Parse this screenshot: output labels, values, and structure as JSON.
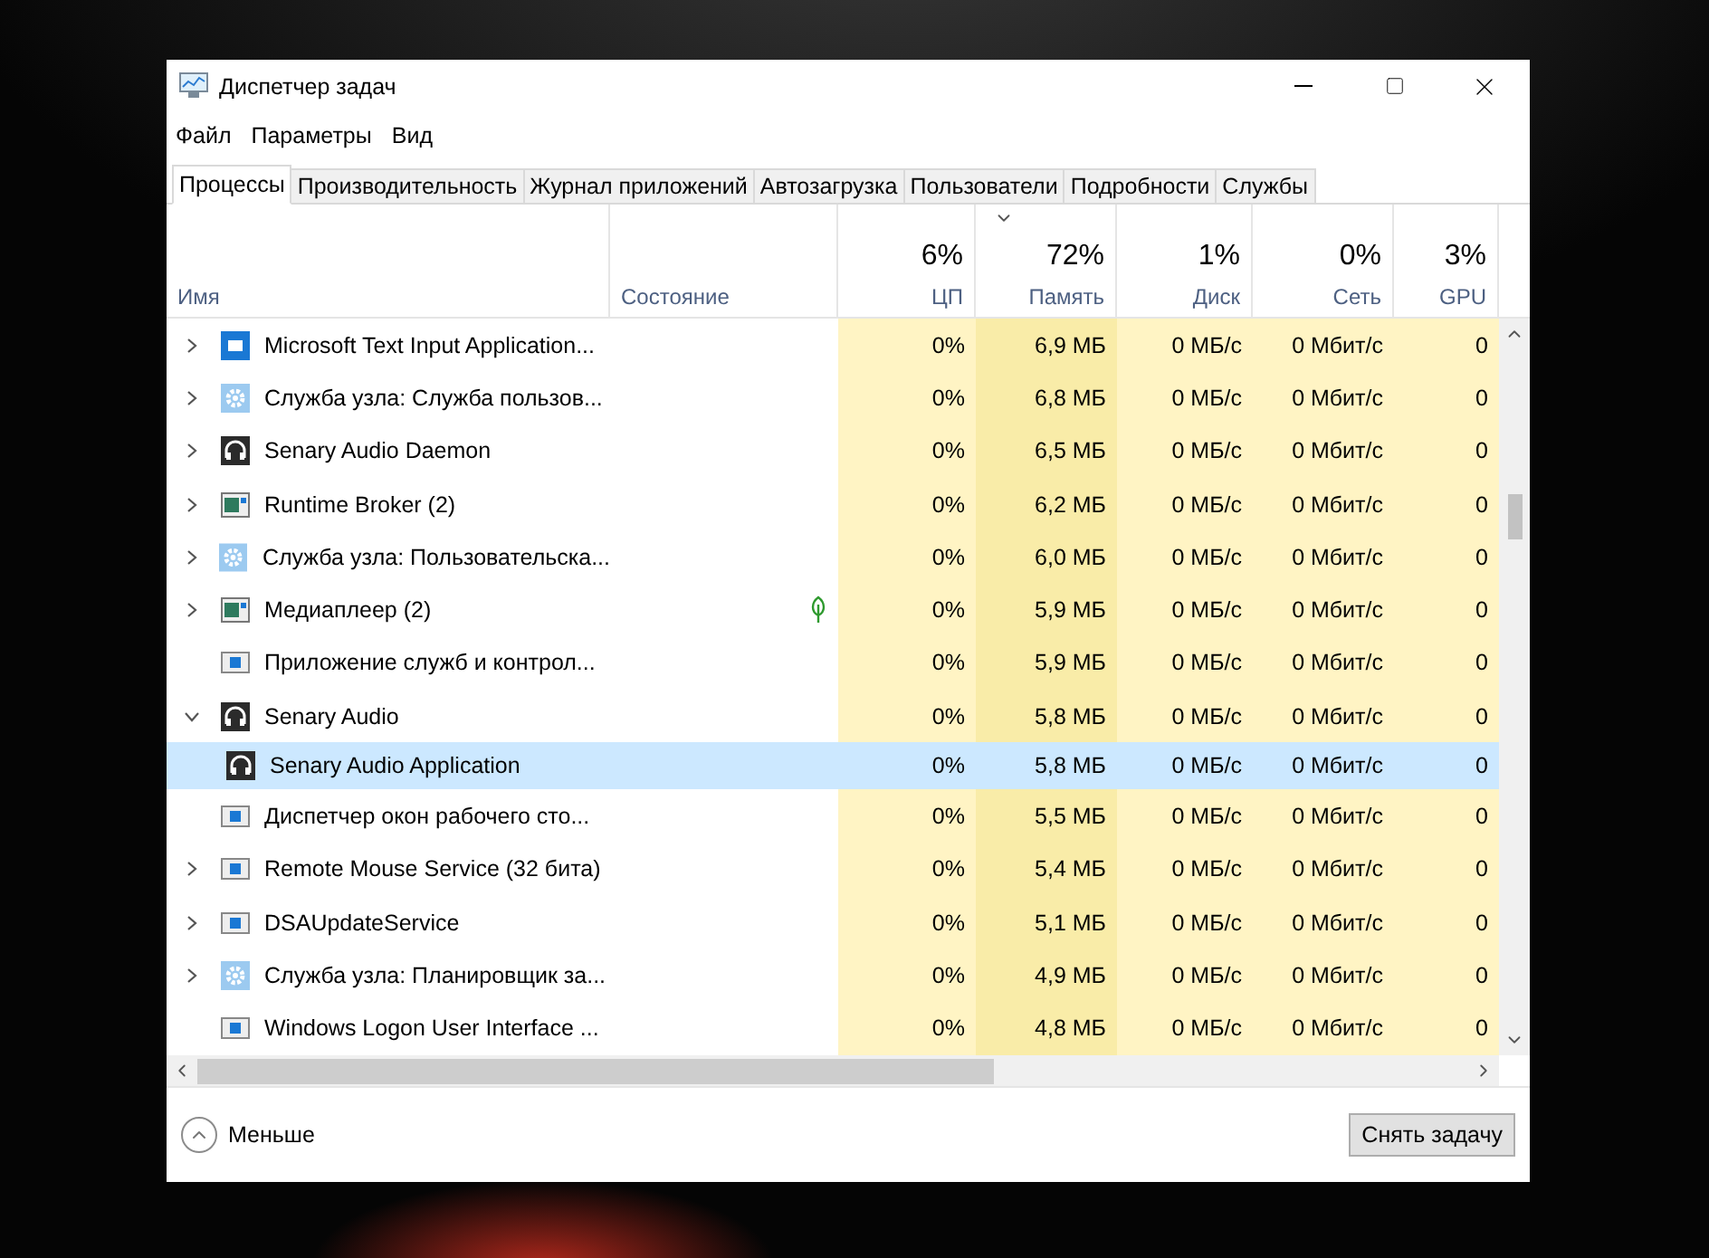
{
  "window": {
    "title": "Диспетчер задач"
  },
  "menu": [
    "Файл",
    "Параметры",
    "Вид"
  ],
  "tabs": [
    {
      "label": "Процессы",
      "selected": true
    },
    {
      "label": "Производительность",
      "selected": false
    },
    {
      "label": "Журнал приложений",
      "selected": false
    },
    {
      "label": "Автозагрузка",
      "selected": false
    },
    {
      "label": "Пользователи",
      "selected": false
    },
    {
      "label": "Подробности",
      "selected": false
    },
    {
      "label": "Службы",
      "selected": false
    }
  ],
  "columns": [
    {
      "label": "Имя"
    },
    {
      "label": "Состояние"
    },
    {
      "percent": "6%",
      "label": "ЦП",
      "sorted": false
    },
    {
      "percent": "72%",
      "label": "Память",
      "sorted": true
    },
    {
      "percent": "1%",
      "label": "Диск",
      "sorted": false
    },
    {
      "percent": "0%",
      "label": "Сеть",
      "sorted": false
    },
    {
      "percent": "3%",
      "label": "GPU",
      "sorted": false
    }
  ],
  "rows": [
    {
      "name": "Microsoft Text Input Application...",
      "kind": "blue-app",
      "expanded": false,
      "selected": false,
      "eco": false,
      "cpu": "0%",
      "memory": "6,9 МБ",
      "disk": "0 МБ/с",
      "network": "0 Мбит/с",
      "gpu": "0"
    },
    {
      "name": "Служба узла: Служба пользов...",
      "kind": "gear",
      "expanded": false,
      "selected": false,
      "eco": false,
      "cpu": "0%",
      "memory": "6,8 МБ",
      "disk": "0 МБ/с",
      "network": "0 Мбит/с",
      "gpu": "0"
    },
    {
      "name": "Senary Audio Daemon",
      "kind": "headphones",
      "expanded": false,
      "selected": false,
      "eco": false,
      "cpu": "0%",
      "memory": "6,5 МБ",
      "disk": "0 МБ/с",
      "network": "0 Мбит/с",
      "gpu": "0"
    },
    {
      "name": "Runtime Broker (2)",
      "kind": "window",
      "expanded": false,
      "selected": false,
      "eco": false,
      "cpu": "0%",
      "memory": "6,2 МБ",
      "disk": "0 МБ/с",
      "network": "0 Мбит/с",
      "gpu": "0"
    },
    {
      "name": "Служба узла: Пользовательска...",
      "kind": "gear",
      "expanded": false,
      "selected": false,
      "eco": false,
      "cpu": "0%",
      "memory": "6,0 МБ",
      "disk": "0 МБ/с",
      "network": "0 Мбит/с",
      "gpu": "0"
    },
    {
      "name": "Медиаплеер (2)",
      "kind": "window",
      "expanded": false,
      "selected": false,
      "eco": true,
      "cpu": "0%",
      "memory": "5,9 МБ",
      "disk": "0 МБ/с",
      "network": "0 Мбит/с",
      "gpu": "0"
    },
    {
      "name": "Приложение служб и контрол...",
      "kind": "service",
      "selected": false,
      "eco": false,
      "cpu": "0%",
      "memory": "5,9 МБ",
      "disk": "0 МБ/с",
      "network": "0 Мбит/с",
      "gpu": "0"
    },
    {
      "name": "Senary Audio",
      "kind": "headphones",
      "expanded": true,
      "selected": false,
      "eco": false,
      "cpu": "0%",
      "memory": "5,8 МБ",
      "disk": "0 МБ/с",
      "network": "0 Мбит/с",
      "gpu": "0",
      "children": [
        {
          "name": "Senary Audio Application",
          "kind": "headphones",
          "selected": true,
          "eco": false,
          "cpu": "0%",
          "memory": "5,8 МБ",
          "disk": "0 МБ/с",
          "network": "0 Мбит/с",
          "gpu": "0"
        }
      ]
    },
    {
      "name": "Диспетчер окон рабочего сто...",
      "kind": "service",
      "selected": false,
      "eco": false,
      "cpu": "0%",
      "memory": "5,5 МБ",
      "disk": "0 МБ/с",
      "network": "0 Мбит/с",
      "gpu": "0"
    },
    {
      "name": "Remote Mouse Service (32 бита)",
      "kind": "service",
      "expanded": false,
      "selected": false,
      "eco": false,
      "cpu": "0%",
      "memory": "5,4 МБ",
      "disk": "0 МБ/с",
      "network": "0 Мбит/с",
      "gpu": "0"
    },
    {
      "name": "DSAUpdateService",
      "kind": "service",
      "expanded": false,
      "selected": false,
      "eco": false,
      "cpu": "0%",
      "memory": "5,1 МБ",
      "disk": "0 МБ/с",
      "network": "0 Мбит/с",
      "gpu": "0"
    },
    {
      "name": "Служба узла: Планировщик за...",
      "kind": "gear",
      "expanded": false,
      "selected": false,
      "eco": false,
      "cpu": "0%",
      "memory": "4,9 МБ",
      "disk": "0 МБ/с",
      "network": "0 Мбит/с",
      "gpu": "0"
    },
    {
      "name": "Windows Logon User Interface ...",
      "kind": "service",
      "selected": false,
      "eco": false,
      "cpu": "0%",
      "memory": "4,8 МБ",
      "disk": "0 МБ/с",
      "network": "0 Мбит/с",
      "gpu": "0"
    }
  ],
  "footer": {
    "fewer": "Меньше",
    "end_task": "Снять задачу"
  }
}
